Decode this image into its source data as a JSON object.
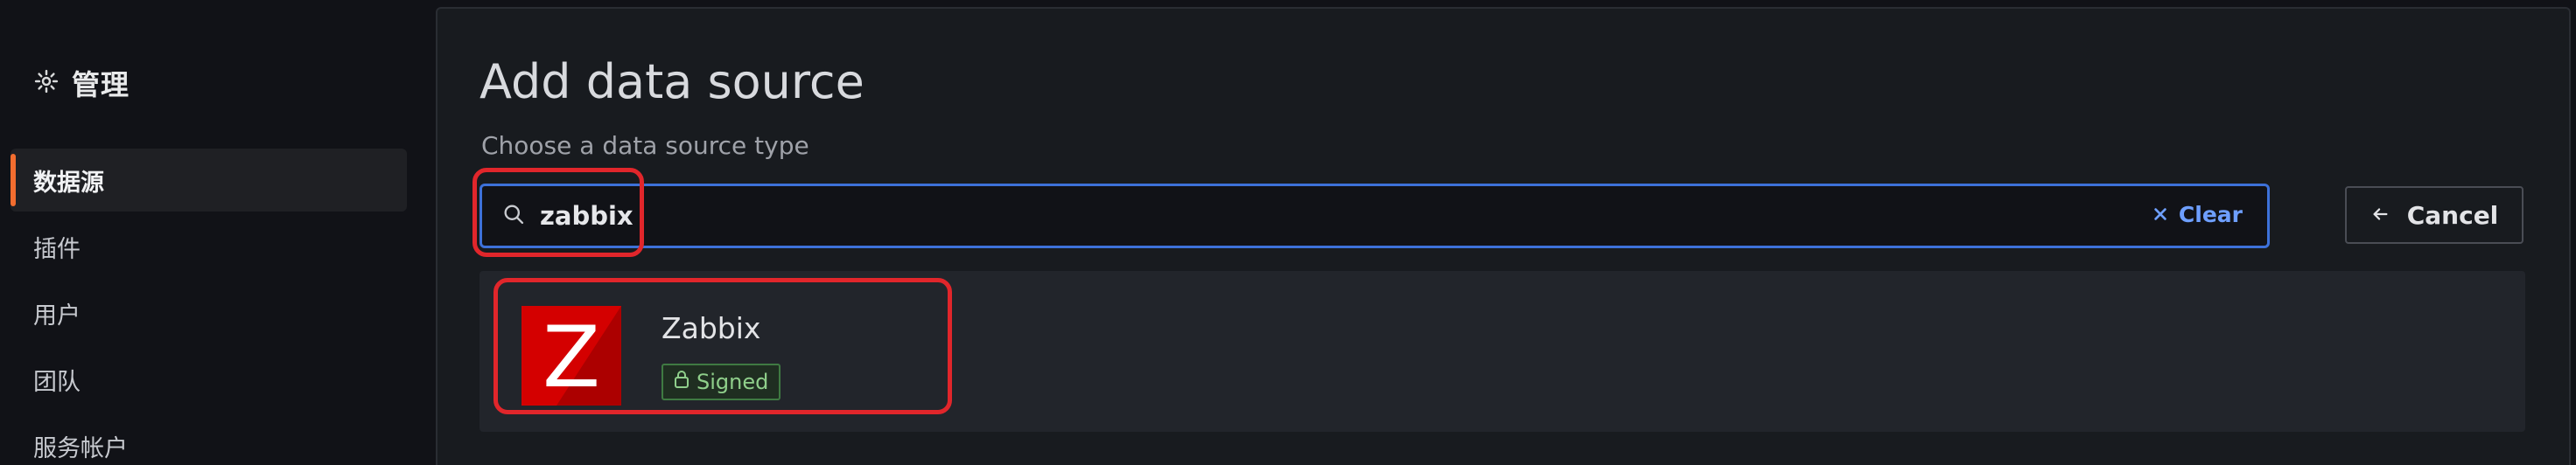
{
  "sidebar": {
    "title": "管理",
    "icon": "gear-icon",
    "items": [
      {
        "label": "数据源",
        "active": true
      },
      {
        "label": "插件",
        "active": false
      },
      {
        "label": "用户",
        "active": false
      },
      {
        "label": "团队",
        "active": false
      },
      {
        "label": "服务帐户",
        "active": false
      }
    ]
  },
  "main": {
    "title": "Add data source",
    "subtitle": "Choose a data source type",
    "search": {
      "value": "zabbix",
      "icon": "search-icon",
      "clear_label": "Clear"
    },
    "cancel_label": "Cancel",
    "results": [
      {
        "name": "Zabbix",
        "logo_letter": "Z",
        "badge": "Signed",
        "badge_icon": "lock-icon"
      }
    ]
  },
  "colors": {
    "accent_active": "#f36d2f",
    "focus_border": "#3d71d9",
    "link_blue": "#6e9fff",
    "annotation_red": "#e1262b",
    "signed_green": "#8fcf8b",
    "zabbix_red": "#d40000"
  }
}
